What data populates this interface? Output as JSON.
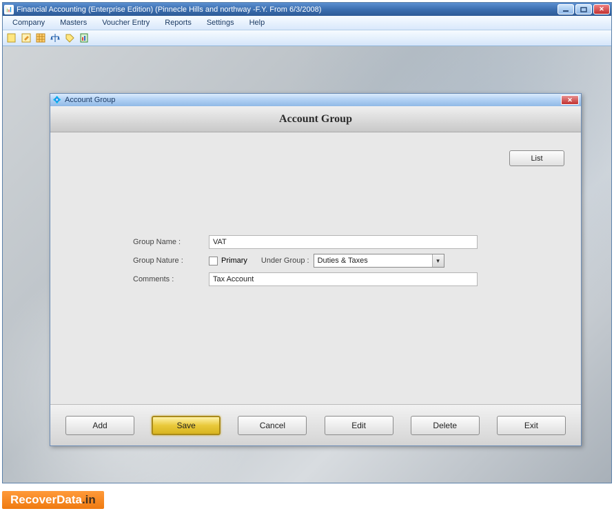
{
  "window": {
    "title": "Financial Accounting (Enterprise Edition) (Pinnecle Hills and northway -F.Y. From 6/3/2008)"
  },
  "menu": {
    "items": [
      "Company",
      "Masters",
      "Voucher Entry",
      "Reports",
      "Settings",
      "Help"
    ]
  },
  "dialog": {
    "title": "Account Group",
    "header": "Account Group",
    "list_btn": "List",
    "labels": {
      "group_name": "Group Name :",
      "group_nature": "Group Nature :",
      "primary": "Primary",
      "under_group": "Under Group :",
      "comments": "Comments :"
    },
    "values": {
      "group_name": "VAT",
      "primary_checked": false,
      "under_group": "Duties & Taxes",
      "comments": "Tax Account"
    },
    "buttons": {
      "add": "Add",
      "save": "Save",
      "cancel": "Cancel",
      "edit": "Edit",
      "delete": "Delete",
      "exit": "Exit"
    }
  },
  "watermark": {
    "brand": "RecoverData",
    "tld": ".in"
  }
}
